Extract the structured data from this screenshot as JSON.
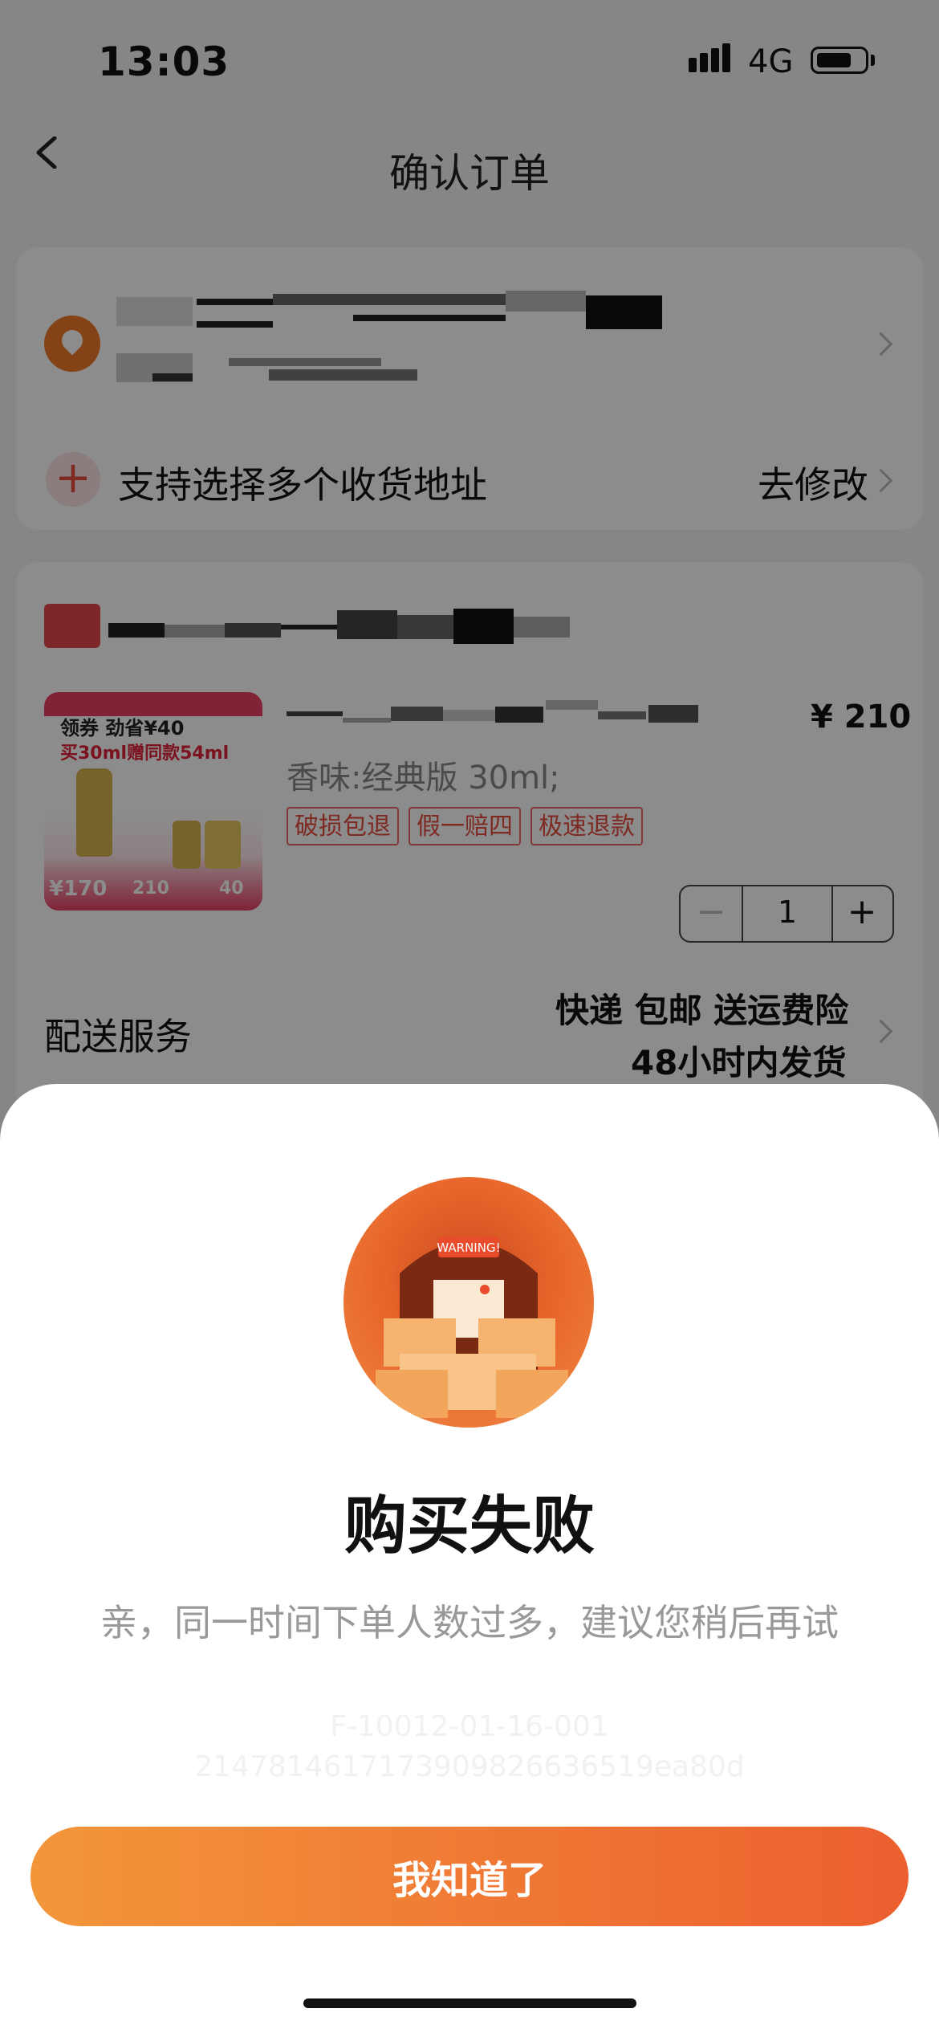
{
  "status_bar": {
    "time": "13:03",
    "network": "4G"
  },
  "nav": {
    "title": "确认订单"
  },
  "address": {
    "multi_label": "支持选择多个收货地址",
    "multi_action": "去修改"
  },
  "product": {
    "price": "¥ 210",
    "spec": "香味:经典版 30ml;",
    "tags": [
      "破损包退",
      "假一赔四",
      "极速退款"
    ],
    "quantity": "1",
    "image_text": {
      "line1": "领券 劲省¥40",
      "line2": "买30ml赠同款54ml",
      "price_old": "¥170",
      "price_new": "210",
      "save": "40"
    }
  },
  "delivery": {
    "label": "配送服务",
    "line1": "快递 包邮 送运费险",
    "line2": "48小时内发货"
  },
  "dialog": {
    "banner": "WARNING!",
    "title": "购买失败",
    "message": "亲，同一时间下单人数过多，建议您稍后再试",
    "code1": "F-10012-01-16-001",
    "code2": "2147814617173909826636519ea80d",
    "button": "我知道了"
  }
}
